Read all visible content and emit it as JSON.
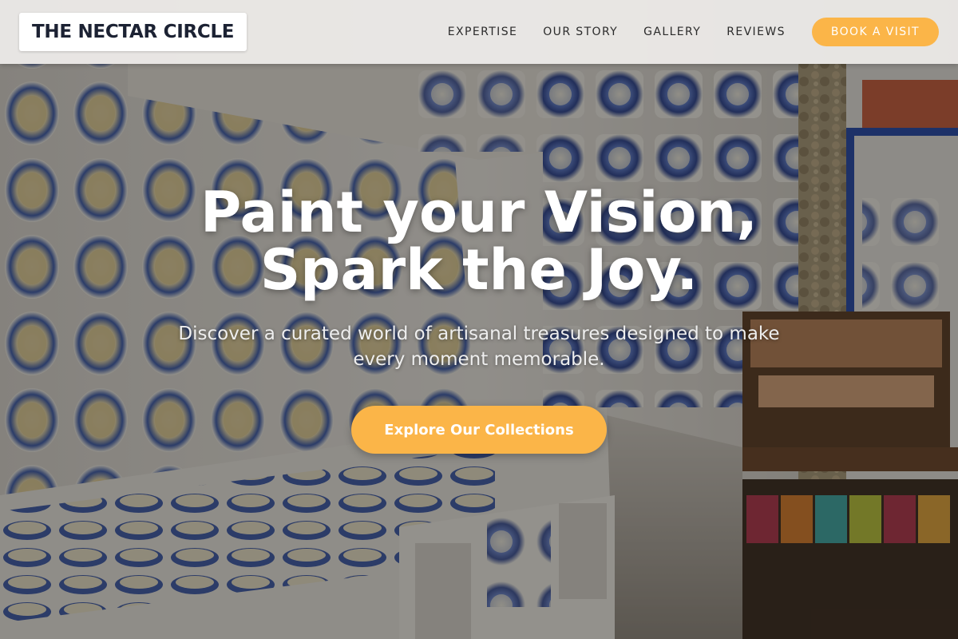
{
  "brand": {
    "name": "THE NECTAR CIRCLE"
  },
  "nav": {
    "links": [
      "EXPERTISE",
      "OUR STORY",
      "GALLERY",
      "REVIEWS"
    ],
    "cta_label": "BOOK A VISIT"
  },
  "hero": {
    "title_line1": "Paint your Vision,",
    "title_line2": "Spark the Joy.",
    "subtitle": "Discover a curated world of artisanal treasures designed to make every moment memorable.",
    "cta_label": "Explore Our Collections",
    "background_image": "pottery-shop-interior"
  },
  "colors": {
    "accent": "#fbb548",
    "logo_text": "#1c2233",
    "nav_background": "#f0eeec"
  }
}
